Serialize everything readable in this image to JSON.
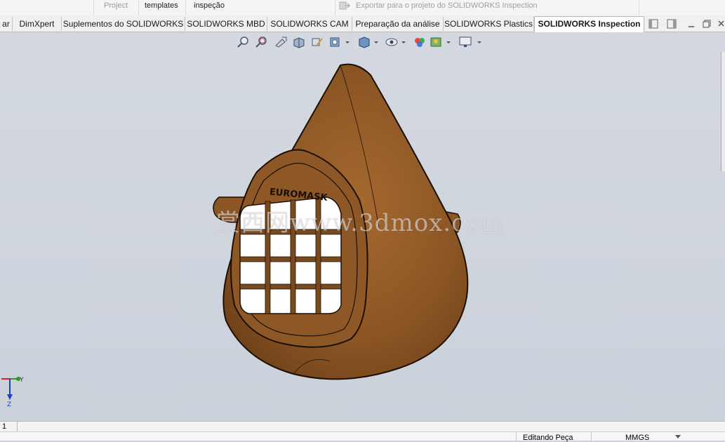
{
  "ribbon": {
    "project_label": "Project",
    "templates_label": "templates",
    "inspection_label": "inspeção",
    "export_label": "Exportar para o projeto do SOLIDWORKS Inspection"
  },
  "tabs": [
    {
      "label": "ar"
    },
    {
      "label": "DimXpert"
    },
    {
      "label": "Suplementos do SOLIDWORKS"
    },
    {
      "label": "SOLIDWORKS MBD"
    },
    {
      "label": "SOLIDWORKS CAM"
    },
    {
      "label": "Preparação da análise"
    },
    {
      "label": "SOLIDWORKS Plastics"
    },
    {
      "label": "SOLIDWORKS Inspection"
    }
  ],
  "view_toolbar": {
    "icons": [
      "zoom-to-fit-icon",
      "zoom-area-icon",
      "previous-view-icon",
      "section-view-icon",
      "dynamic-annotation-icon",
      "view-orientation-icon",
      "display-style-icon",
      "hide-show-icon",
      "edit-appearance-icon",
      "apply-scene-icon",
      "view-settings-icon"
    ]
  },
  "model": {
    "brand_text": "EUROMASK",
    "colors": {
      "body": "#8b5524",
      "edge": "#1b0f05",
      "highlight": "#a4692f"
    }
  },
  "watermark": "赏西网www.3dmox.com",
  "triad": {
    "y_label": "Y",
    "z_label": "Z"
  },
  "status": {
    "sheet_tab": "1",
    "mode": "Editando Peça",
    "units": "MMGS"
  },
  "colors": {
    "viewport_bg": "#cdd3dc",
    "active_tab_bg": "#ffffff"
  }
}
